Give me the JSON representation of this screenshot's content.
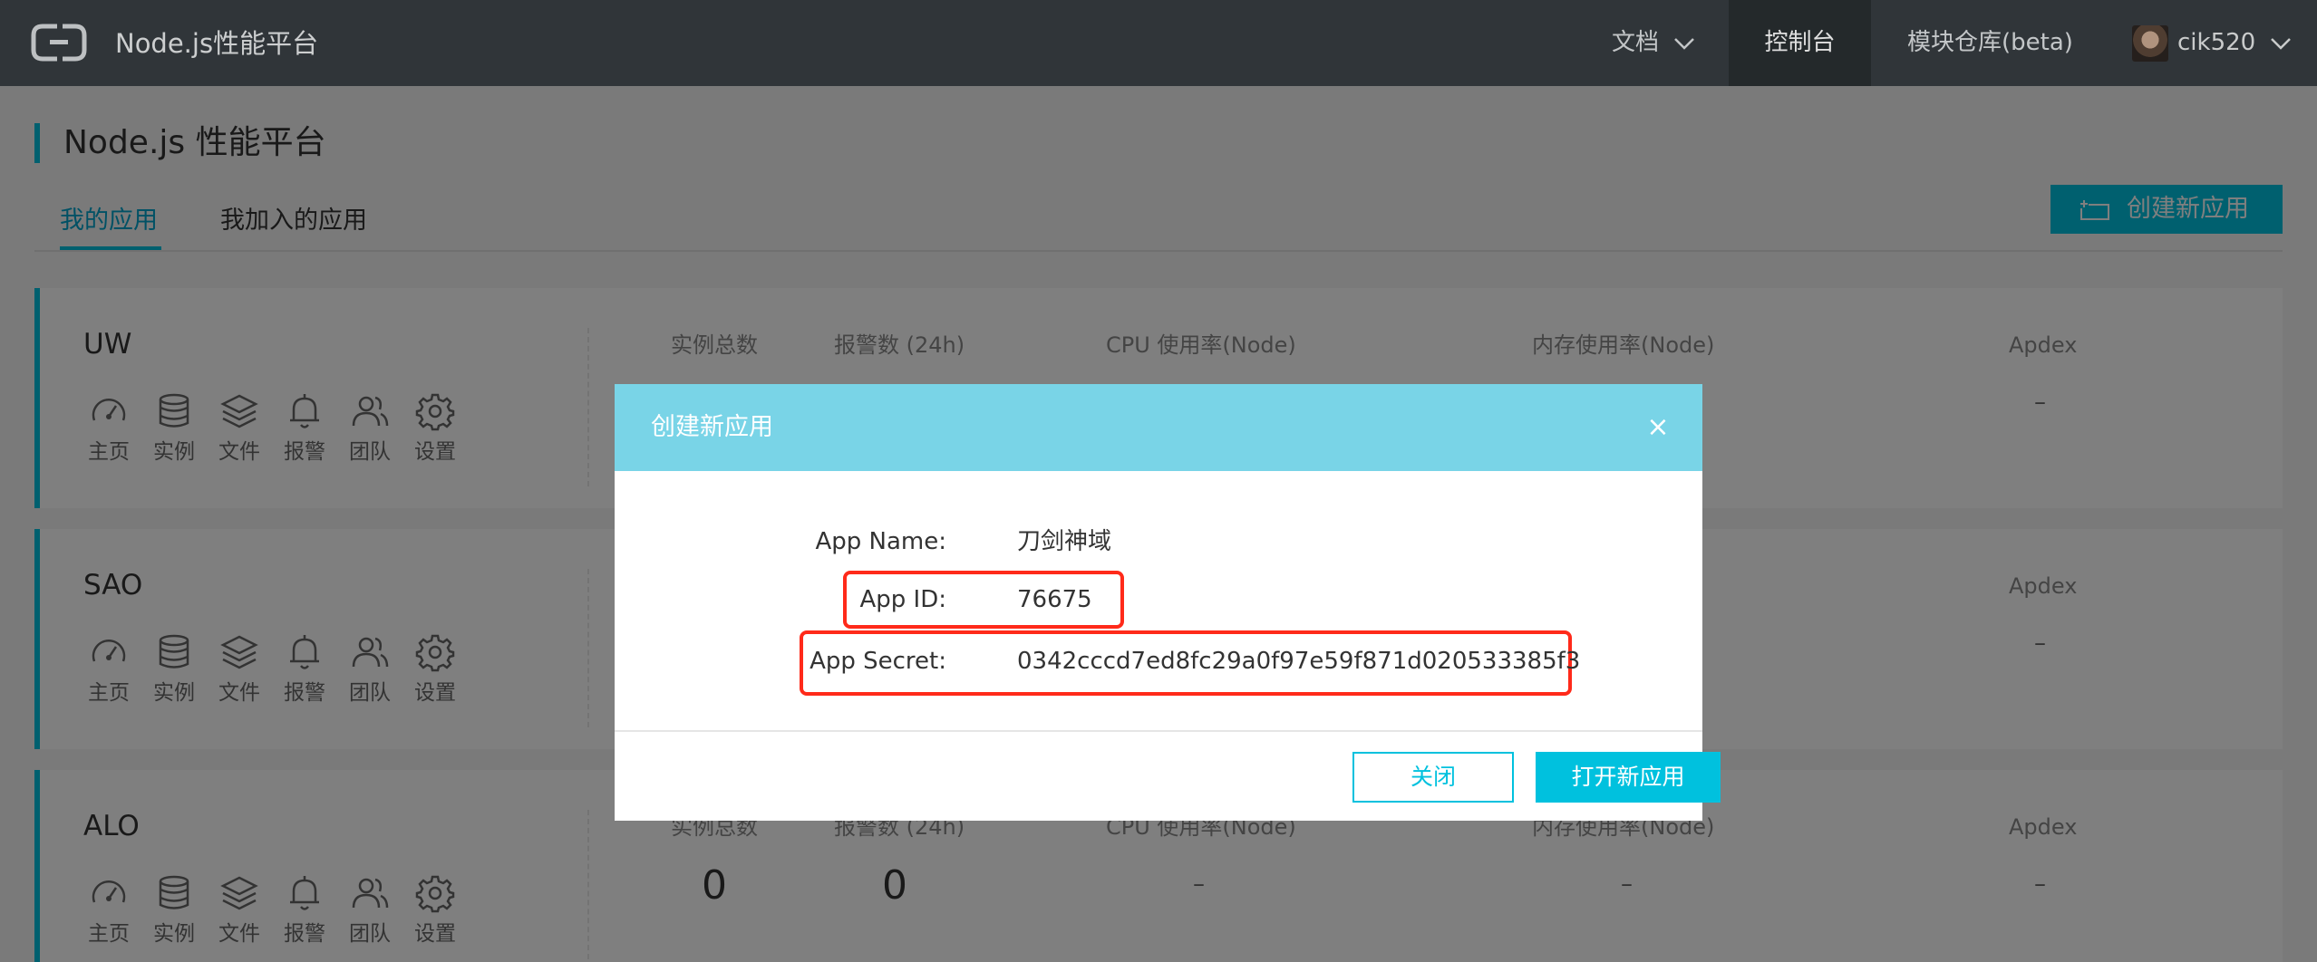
{
  "topnav": {
    "brand": "Node.js性能平台",
    "docs": "文档",
    "console": "控制台",
    "modules": "模块仓库(beta)",
    "username": "cik520"
  },
  "page": {
    "title": "Node.js 性能平台",
    "tabs": [
      "我的应用",
      "我加入的应用"
    ],
    "create_button": "创建新应用"
  },
  "tools": [
    {
      "label": "主页",
      "icon": "dashboard-icon"
    },
    {
      "label": "实例",
      "icon": "database-icon"
    },
    {
      "label": "文件",
      "icon": "layers-icon"
    },
    {
      "label": "报警",
      "icon": "bell-icon"
    },
    {
      "label": "团队",
      "icon": "team-icon"
    },
    {
      "label": "设置",
      "icon": "gear-icon"
    }
  ],
  "metric_headers": [
    "实例总数",
    "报警数 (24h)",
    "CPU 使用率(Node)",
    "内存使用率(Node)",
    "Apdex"
  ],
  "apps": [
    {
      "name": "UW",
      "instances": "",
      "alarms": "",
      "cpu": "",
      "mem": "",
      "apdex": "–"
    },
    {
      "name": "SAO",
      "instances": "",
      "alarms": "",
      "cpu": "",
      "mem": "",
      "apdex": "–"
    },
    {
      "name": "ALO",
      "instances": "0",
      "alarms": "0",
      "cpu": "–",
      "mem": "–",
      "apdex": "–"
    }
  ],
  "modal": {
    "title": "创建新应用",
    "close_icon": "×",
    "app_name_label": "App Name:",
    "app_name": "刀剑神域",
    "app_id_label": "App ID:",
    "app_id": "76675",
    "app_secret_label": "App Secret:",
    "app_secret": "0342cccd7ed8fc29a0f97e59f871d020533385f3",
    "btn_close": "关闭",
    "btn_open": "打开新应用"
  },
  "colors": {
    "accent": "#00c1de",
    "nav_bg": "#373d41",
    "modal_header": "#79d4e7",
    "highlight": "#ff2a1a"
  }
}
